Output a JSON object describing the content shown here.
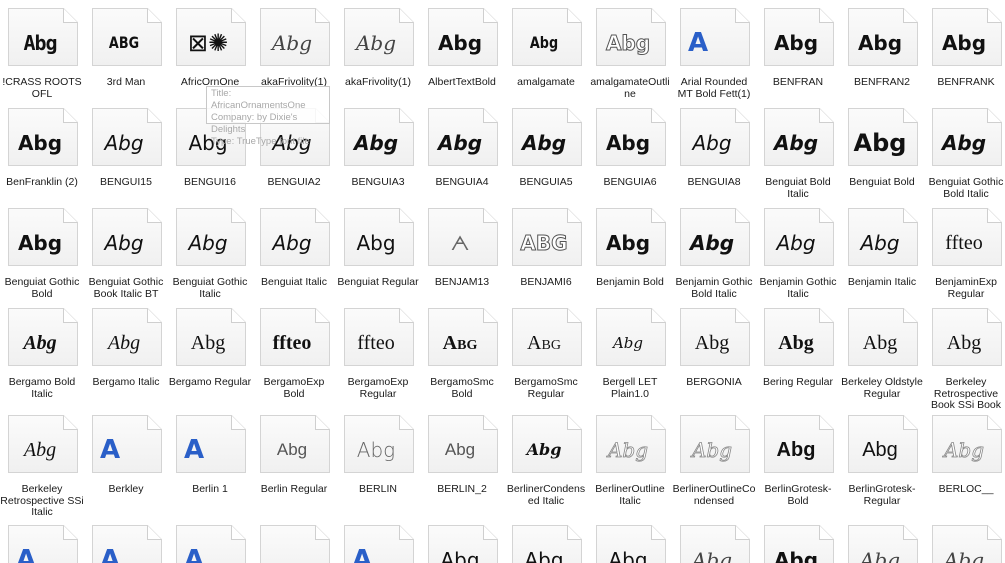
{
  "fonts": [
    [
      {
        "name": "!CRASS ROOTS OFL",
        "sample": "Abg",
        "style": "stencil"
      },
      {
        "name": "3rd Man",
        "sample": "ABG",
        "style": "cond"
      },
      {
        "name": "AfricOrnOne",
        "sample": "⊠✺",
        "style": "orn"
      },
      {
        "name": "akaFrivolity(1)",
        "sample": "Abg",
        "style": "script"
      },
      {
        "name": "akaFrivolity(1)",
        "sample": "Abg",
        "style": "script"
      },
      {
        "name": "AlbertTextBold",
        "sample": "Abg",
        "style": "black"
      },
      {
        "name": "amalgamate",
        "sample": "Abg",
        "style": "cond"
      },
      {
        "name": "amalgamateOutline",
        "sample": "Abg",
        "style": "outline"
      },
      {
        "name": "Arial Rounded MT Bold Fett(1)",
        "sample": "A",
        "style": "blueA"
      },
      {
        "name": "BENFRAN",
        "sample": "Abg",
        "style": "bold"
      },
      {
        "name": "BENFRAN2",
        "sample": "Abg",
        "style": "bold"
      },
      {
        "name": "BENFRANK",
        "sample": "Abg",
        "style": "bold"
      }
    ],
    [
      {
        "name": "BenFranklin (2)",
        "sample": "Abg",
        "style": "bold"
      },
      {
        "name": "BENGUI15",
        "sample": "Abg",
        "style": "italic"
      },
      {
        "name": "BENGUI16",
        "sample": "Abg",
        "style": "regular"
      },
      {
        "name": "BENGUIA2",
        "sample": "Abg",
        "style": "italic"
      },
      {
        "name": "BENGUIA3",
        "sample": "Abg",
        "style": "bolditalic"
      },
      {
        "name": "BENGUIA4",
        "sample": "Abg",
        "style": "bolditalic"
      },
      {
        "name": "BENGUIA5",
        "sample": "Abg",
        "style": "bolditalic"
      },
      {
        "name": "BENGUIA6",
        "sample": "Abg",
        "style": "bold"
      },
      {
        "name": "BENGUIA8",
        "sample": "Abg",
        "style": "italic"
      },
      {
        "name": "Benguiat Bold Italic",
        "sample": "Abg",
        "style": "bolditalic"
      },
      {
        "name": "Benguiat Bold",
        "sample": "Abg",
        "style": "bigbold"
      },
      {
        "name": "Benguiat Gothic Bold Italic",
        "sample": "Abg",
        "style": "bolditalic"
      }
    ],
    [
      {
        "name": "Benguiat Gothic Bold",
        "sample": "Abg",
        "style": "bold"
      },
      {
        "name": "Benguiat Gothic Book Italic BT",
        "sample": "Abg",
        "style": "italic"
      },
      {
        "name": "Benguiat Gothic Italic",
        "sample": "Abg",
        "style": "italic"
      },
      {
        "name": "Benguiat Italic",
        "sample": "Abg",
        "style": "italic"
      },
      {
        "name": "Benguiat Regular",
        "sample": "Abg",
        "style": "regular"
      },
      {
        "name": "BENJAM13",
        "sample": "ᗅ",
        "style": "thin"
      },
      {
        "name": "BENJAMI6",
        "sample": "ABG",
        "style": "outline"
      },
      {
        "name": "Benjamin Bold",
        "sample": "Abg",
        "style": "bold"
      },
      {
        "name": "Benjamin Gothic Bold Italic",
        "sample": "Abg",
        "style": "bolditalic"
      },
      {
        "name": "Benjamin Gothic Italic",
        "sample": "Abg",
        "style": "italic"
      },
      {
        "name": "Benjamin Italic",
        "sample": "Abg",
        "style": "italic"
      },
      {
        "name": "BenjaminExp Regular",
        "sample": "ffteo",
        "style": "serif"
      }
    ],
    [
      {
        "name": "Bergamo Bold Italic",
        "sample": "Abg",
        "style": "serifbolditalic"
      },
      {
        "name": "Bergamo Italic",
        "sample": "Abg",
        "style": "serifitalic"
      },
      {
        "name": "Bergamo Regular",
        "sample": "Abg",
        "style": "serif"
      },
      {
        "name": "BergamoExp Bold",
        "sample": "ffteo",
        "style": "serifbold"
      },
      {
        "name": "BergamoExp Regular",
        "sample": "ffteo",
        "style": "serif"
      },
      {
        "name": "BergamoSmc Bold",
        "sample": "Abg",
        "style": "smcbold"
      },
      {
        "name": "BergamoSmc Regular",
        "sample": "Abg",
        "style": "smc"
      },
      {
        "name": "Bergell LET Plain1.0",
        "sample": "Abg",
        "style": "hand"
      },
      {
        "name": "BERGONIA",
        "sample": "Abg",
        "style": "serif"
      },
      {
        "name": "Bering Regular",
        "sample": "Abg",
        "style": "serifbold"
      },
      {
        "name": "Berkeley Oldstyle Regular",
        "sample": "Abg",
        "style": "serif"
      },
      {
        "name": "Berkeley Retrospective Book SSi Book",
        "sample": "Abg",
        "style": "serif"
      }
    ],
    [
      {
        "name": "Berkeley Retrospective SSi Italic",
        "sample": "Abg",
        "style": "serifitalic"
      },
      {
        "name": "Berkley",
        "sample": "A",
        "style": "blueA"
      },
      {
        "name": "Berlin 1",
        "sample": "A",
        "style": "blueA"
      },
      {
        "name": "Berlin Regular",
        "sample": "Abg",
        "style": "light"
      },
      {
        "name": "BERLIN",
        "sample": "Abg",
        "style": "thin"
      },
      {
        "name": "BERLIN_2",
        "sample": "Abg",
        "style": "light"
      },
      {
        "name": "BerlinerCondensed Italic",
        "sample": "Abg",
        "style": "fraktur"
      },
      {
        "name": "BerlinerOutline Italic",
        "sample": "Abg",
        "style": "outlineserif"
      },
      {
        "name": "BerlinerOutlineCondensed",
        "sample": "Abg",
        "style": "outlineserif"
      },
      {
        "name": "BerlinGrotesk-Bold",
        "sample": "Abg",
        "style": "sansbold"
      },
      {
        "name": "BerlinGrotesk-Regular",
        "sample": "Abg",
        "style": "sans"
      },
      {
        "name": "BERLOC__",
        "sample": "Abg",
        "style": "outlineserif"
      }
    ],
    [
      {
        "name": "",
        "sample": "A",
        "style": "blueA"
      },
      {
        "name": "",
        "sample": "A",
        "style": "blueA"
      },
      {
        "name": "",
        "sample": "A",
        "style": "blueA"
      },
      {
        "name": "",
        "sample": "",
        "style": "regular"
      },
      {
        "name": "",
        "sample": "A",
        "style": "blueA"
      },
      {
        "name": "",
        "sample": "Abg",
        "style": "regular"
      },
      {
        "name": "",
        "sample": "Abg",
        "style": "regular"
      },
      {
        "name": "",
        "sample": "Abg",
        "style": "regular"
      },
      {
        "name": "",
        "sample": "Abg",
        "style": "script"
      },
      {
        "name": "",
        "sample": "Abg",
        "style": "black"
      },
      {
        "name": "",
        "sample": "Abg",
        "style": "script"
      },
      {
        "name": "",
        "sample": "Abg",
        "style": "script"
      }
    ]
  ],
  "tooltip": {
    "title": "Title: AfricanOrnamentsOne",
    "company": "Company: by Dixie's Delights",
    "type": "Type: TrueType font file"
  }
}
